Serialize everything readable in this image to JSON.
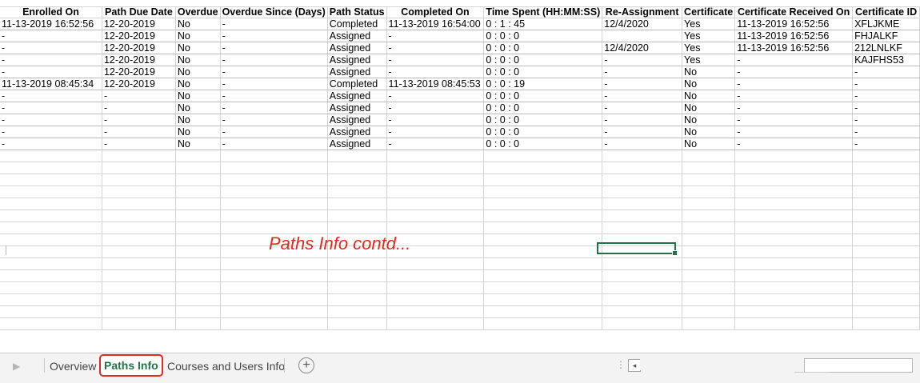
{
  "grid": {
    "headers": [
      "Enrolled On",
      "Path Due Date",
      "Overdue",
      "Overdue Since (Days)",
      "Path Status",
      "Completed On",
      "Time Spent (HH:MM:SS)",
      "Re-Assignment",
      "Certificate",
      "Certificate Received On",
      "Certificate ID"
    ],
    "rows": [
      [
        "11-13-2019 16:52:56",
        "12-20-2019",
        "No",
        "-",
        "Completed",
        "11-13-2019 16:54:00",
        "0 : 1 : 45",
        "12/4/2020",
        "Yes",
        "11-13-2019 16:52:56",
        "XFLJKME"
      ],
      [
        "-",
        "12-20-2019",
        "No",
        "-",
        "Assigned",
        "-",
        "0 : 0 : 0",
        "",
        "Yes",
        "11-13-2019 16:52:56",
        "FHJALKF"
      ],
      [
        "-",
        "12-20-2019",
        "No",
        "-",
        "Assigned",
        "-",
        "0 : 0 : 0",
        "12/4/2020",
        "Yes",
        "11-13-2019 16:52:56",
        "212LNLKF"
      ],
      [
        "-",
        "12-20-2019",
        "No",
        "-",
        "Assigned",
        "-",
        "0 : 0 : 0",
        "-",
        "Yes",
        "-",
        "KAJFHS53"
      ],
      [
        "-",
        "12-20-2019",
        "No",
        "-",
        "Assigned",
        "-",
        "0 : 0 : 0",
        "-",
        "No",
        "-",
        "-"
      ],
      [
        "11-13-2019 08:45:34",
        "12-20-2019",
        "No",
        "-",
        "Completed",
        "11-13-2019 08:45:53",
        "0 : 0 : 19",
        "-",
        "No",
        "-",
        "-"
      ],
      [
        "-",
        "-",
        "No",
        "-",
        "Assigned",
        "-",
        "0 : 0 : 0",
        "-",
        "No",
        "-",
        "-"
      ],
      [
        "-",
        "-",
        "No",
        "-",
        "Assigned",
        "-",
        "0 : 0 : 0",
        "-",
        "No",
        "-",
        "-"
      ],
      [
        "-",
        "-",
        "No",
        "-",
        "Assigned",
        "-",
        "0 : 0 : 0",
        "-",
        "No",
        "-",
        "-"
      ],
      [
        "-",
        "-",
        "No",
        "-",
        "Assigned",
        "-",
        "0 : 0 : 0",
        "-",
        "No",
        "-",
        "-"
      ],
      [
        "-",
        "-",
        "No",
        "-",
        "Assigned",
        "-",
        "0 : 0 : 0",
        "-",
        "No",
        "-",
        "-"
      ]
    ]
  },
  "annotation": "Paths Info contd...",
  "tabs": {
    "items": [
      "Overview",
      "Paths Info",
      "Courses and Users Info"
    ],
    "active": "Paths Info",
    "add_icon": "plus-circle-icon",
    "nav_icon": "triangle-right-icon"
  },
  "colors": {
    "accent": "#217346",
    "annotation": "#e8271f"
  }
}
